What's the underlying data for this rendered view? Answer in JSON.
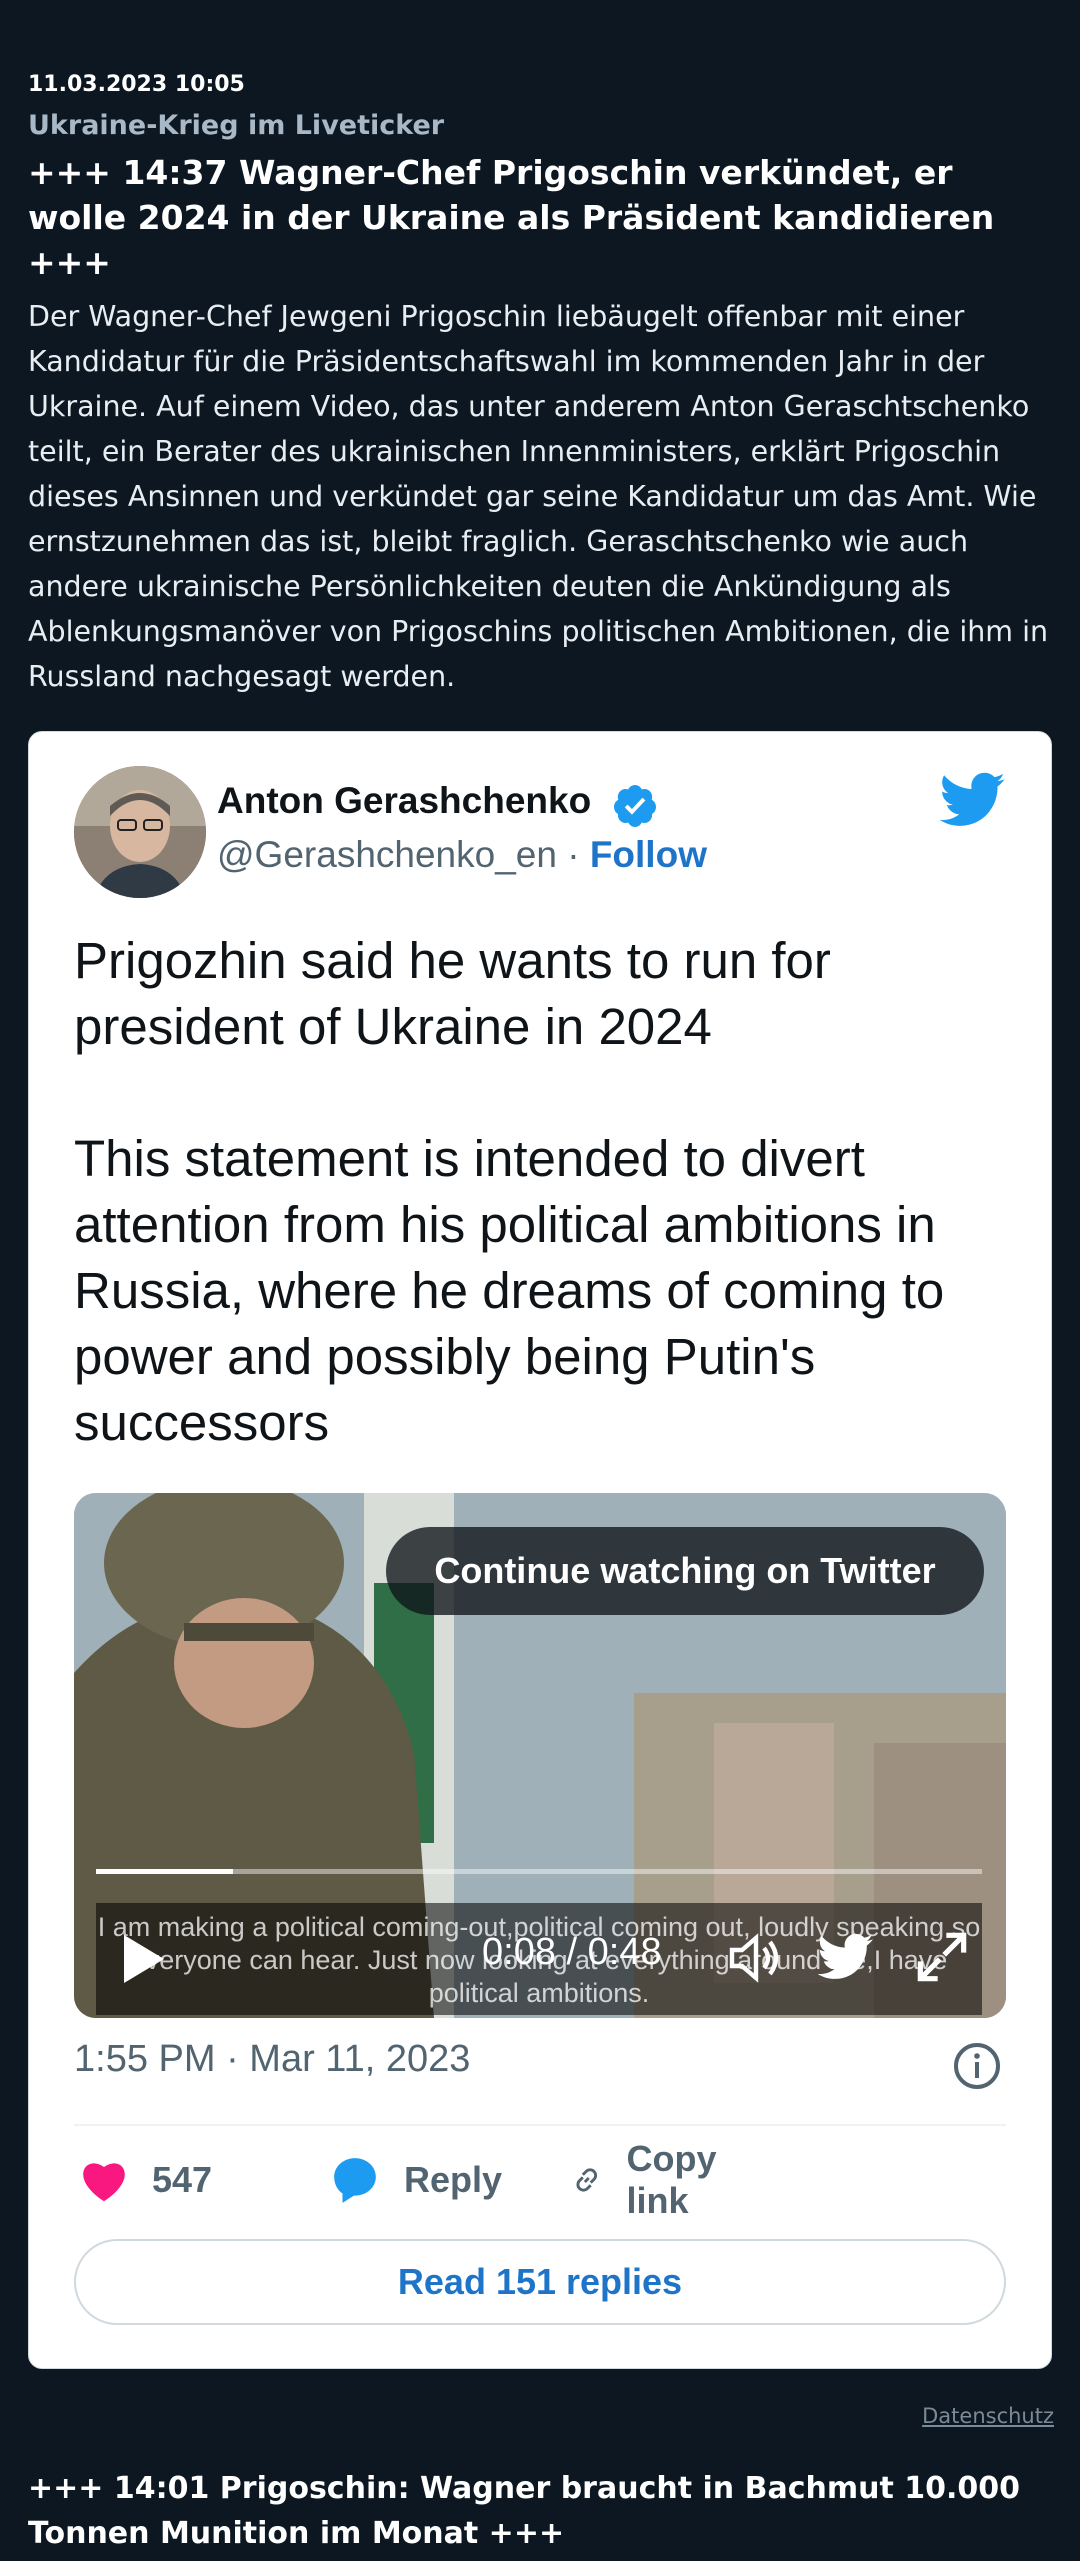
{
  "article": {
    "date": "11.03.2023 10:05",
    "kicker": "Ukraine-Krieg im Liveticker",
    "headline": "+++ 14:37 Wagner-Chef Prigoschin verkündet, er wolle 2024 in der Ukraine als Präsident kandidieren +++",
    "body": "Der Wagner-Chef Jewgeni Prigoschin liebäugelt offenbar mit einer Kandidatur für die Präsidentschaftswahl im kommenden Jahr in der Ukraine. Auf einem Video, das unter anderem Anton Geraschtschenko teilt, ein Berater des ukrainischen Innenministers, erklärt Prigoschin dieses Ansinnen und verkündet gar seine Kandidatur um das Amt. Wie ernstzunehmen das ist, bleibt fraglich. Geraschtschenko wie auch andere ukrainische Persönlichkeiten deuten die Ankündigung als Ablenkungsmanöver von Prigoschins politischen Ambitionen, die ihm in Russland nachgesagt werden."
  },
  "tweet": {
    "author": "Anton Gerashchenko",
    "handle": "@Gerashchenko_en",
    "separator": " · ",
    "follow": "Follow",
    "text": "Prigozhin said he wants to run for president of Ukraine in 2024\n\nThis statement is intended to divert attention from his political ambitions in Russia, where he dreams of coming to power and possibly being Putin's successors",
    "video": {
      "continue_label": "Continue watching on Twitter",
      "caption": "I am making a political coming-out,political coming out, loudly speaking so everyone can hear. Just now looking at everything around me,I have political ambitions.",
      "time": "0:08 / 0:48",
      "progress": 0.155
    },
    "timestamp": "1:55 PM · Mar 11, 2023",
    "likes": "547",
    "reply_label": "Reply",
    "copy_label": "Copy link",
    "read_replies": "Read 151 replies",
    "colors": {
      "blue": "#1d9bf0",
      "like": "#f91880",
      "link": "#1d74c8"
    },
    "icons": [
      "verified-badge-icon",
      "twitter-bird-icon",
      "play-icon",
      "volume-icon",
      "fullscreen-icon",
      "info-icon",
      "heart-icon",
      "reply-bubble-icon",
      "link-icon"
    ]
  },
  "footer": {
    "privacy_link": "Datenschutz",
    "next_headline": "+++ 14:01 Prigoschin: Wagner braucht in Bachmut 10.000 Tonnen Munition im Monat +++"
  }
}
